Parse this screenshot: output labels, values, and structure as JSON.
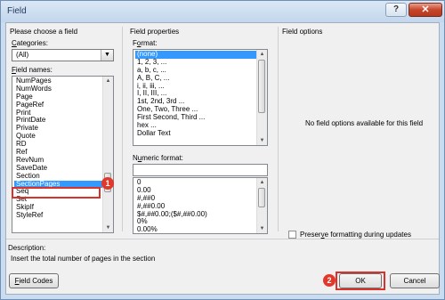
{
  "window": {
    "title": "Field",
    "help_label": "?",
    "close_label": "✕"
  },
  "left": {
    "heading": "Please choose a field",
    "categories_label_pre": "",
    "categories_label_ul": "C",
    "categories_label_post": "ategories:",
    "categories_value": "(All)",
    "field_names_label_pre": "",
    "field_names_label_ul": "F",
    "field_names_label_post": "ield names:",
    "field_names": [
      "NumPages",
      "NumWords",
      "Page",
      "PageRef",
      "Print",
      "PrintDate",
      "Private",
      "Quote",
      "RD",
      "Ref",
      "RevNum",
      "SaveDate",
      "Section",
      "SectionPages",
      "Seq",
      "Set",
      "SkipIf",
      "StyleRef"
    ],
    "selected_field": "SectionPages"
  },
  "middle": {
    "heading": "Field properties",
    "format_label_pre": "F",
    "format_label_ul": "o",
    "format_label_post": "rmat:",
    "formats": [
      "(none)",
      "1, 2, 3, ...",
      "a, b, c, ...",
      "A, B, C, ...",
      "i, ii, iii, ...",
      "I, II, III, ...",
      "1st, 2nd, 3rd ...",
      "One, Two, Three ...",
      "First Second, Third ...",
      "hex ...",
      "Dollar Text"
    ],
    "numeric_label_pre": "N",
    "numeric_label_ul": "u",
    "numeric_label_post": "meric format:",
    "numeric_value": "",
    "numeric_formats": [
      "0",
      "0.00",
      "#,##0",
      "#,##0.00",
      "$#,##0.00;($#,##0.00)",
      "0%",
      "0.00%"
    ]
  },
  "right": {
    "heading": "Field options",
    "no_options_text": "No field options available for this field",
    "preserve_pre": "Preser",
    "preserve_ul": "v",
    "preserve_post": "e formatting during updates"
  },
  "description": {
    "label": "Description:",
    "text": "Insert the total number of pages in the section"
  },
  "buttons": {
    "field_codes_ul": "F",
    "field_codes_rest": "ield Codes",
    "ok": "OK",
    "cancel": "Cancel"
  },
  "callouts": {
    "badge1": "1",
    "badge2": "2",
    "color": "#e0392b"
  }
}
